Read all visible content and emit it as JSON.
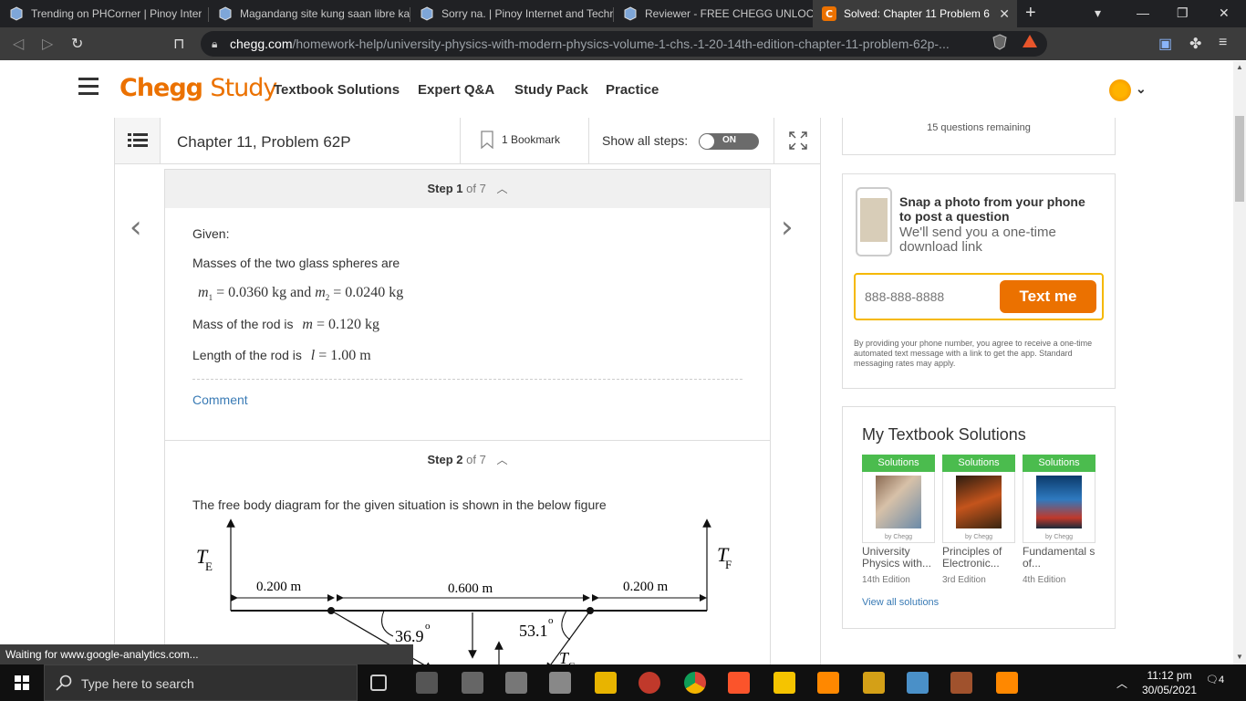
{
  "browser": {
    "tabs": [
      {
        "title": "Trending on PHCorner | Pinoy Inter",
        "active": false
      },
      {
        "title": "Magandang site kung saan libre ka",
        "active": false
      },
      {
        "title": "Sorry na. | Pinoy Internet and Techr",
        "active": false
      },
      {
        "title": "Reviewer - FREE CHEGG UNLOCKS",
        "active": false
      },
      {
        "title": "Solved: Chapter 11 Problem 62",
        "active": true
      }
    ],
    "url_host": "chegg.com",
    "url_path": "/homework-help/university-physics-with-modern-physics-volume-1-chs.-1-20-14th-edition-chapter-11-problem-62p-..."
  },
  "header": {
    "logo_chegg": "Chegg",
    "logo_study": "Study",
    "nav": [
      "Textbook Solutions",
      "Expert Q&A",
      "Study Pack",
      "Practice"
    ]
  },
  "toolbar": {
    "chapter_title": "Chapter 11, Problem 62P",
    "bookmark_label": "1 Bookmark",
    "show_steps_label": "Show all steps:",
    "toggle_label": "ON"
  },
  "steps": [
    {
      "label": "Step 1",
      "of": "of 7",
      "lines": {
        "given": "Given:",
        "masses_intro": "Masses of the two glass spheres are",
        "m1_sym": "m",
        "m1_sub": "1",
        "m1_val": "= 0.0360 kg",
        "and": "and",
        "m2_sym": "m",
        "m2_sub": "2",
        "m2_val": "= 0.0240 kg",
        "rod_mass_intro": "Mass of the rod is",
        "rod_mass_sym": "m",
        "rod_mass_val": "= 0.120 kg",
        "rod_len_intro": "Length of the rod is",
        "rod_len_sym": "l",
        "rod_len_val": "= 1.00 m"
      },
      "comment": "Comment"
    },
    {
      "label": "Step 2",
      "of": "of 7",
      "intro": "The free body diagram for the given situation is shown in the below figure",
      "diagram": {
        "te_main": "T",
        "te_sub": "E",
        "tf_main": "T",
        "tf_sub": "F",
        "tc_main": "T",
        "tc_sub": "C",
        "dist_left": "0.200 m",
        "dist_mid": "0.600 m",
        "dist_right": "0.200 m",
        "angle_left": "36.9",
        "angle_right": "53.1",
        "degree": "o"
      }
    }
  ],
  "sidebar": {
    "remaining": "15 questions remaining",
    "snap_title": "Snap a photo from your phone to post a question",
    "snap_sub": "We'll send you a one-time download link",
    "phone_placeholder": "888-888-8888",
    "textme_label": "Text me",
    "disclaimer": "By providing your phone number, you agree to receive a one-time automated text message with a link to get the app. Standard messaging rates may apply.",
    "textbooks_title": "My Textbook Solutions",
    "books": [
      {
        "badge": "Solutions",
        "by": "by Chegg",
        "name": "University Physics with...",
        "edition": "14th Edition"
      },
      {
        "badge": "Solutions",
        "by": "by Chegg",
        "name": "Principles of Electronic...",
        "edition": "3rd Edition"
      },
      {
        "badge": "Solutions",
        "by": "by Chegg",
        "name": "Fundamental s of...",
        "edition": "4th Edition"
      }
    ],
    "view_all": "View all solutions"
  },
  "status_text": "Waiting for www.google-analytics.com...",
  "taskbar": {
    "search_placeholder": "Type here to search",
    "time": "11:12 pm",
    "date": "30/05/2021",
    "notifications": "4"
  },
  "colors": {
    "chegg_orange": "#eb7100",
    "solutions_green": "#4bbc4e",
    "link_blue": "#3a7bb5",
    "phone_border": "#f5b800"
  }
}
